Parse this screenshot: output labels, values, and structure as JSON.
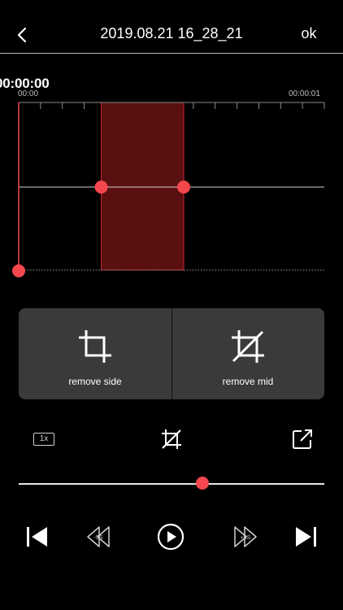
{
  "header": {
    "title": "2019.08.21 16_28_21",
    "ok_label": "ok",
    "back_icon": "chevron-left-icon"
  },
  "timeline": {
    "current_time": "00:00:00",
    "start_label": "00:00",
    "end_label": "00:00:01",
    "selection_start_fraction": 0.27,
    "selection_end_fraction": 0.54,
    "playhead_fraction": 0.0
  },
  "actions": {
    "remove_side_label": "remove side",
    "remove_mid_label": "remove mid"
  },
  "toolbar": {
    "speed_label": "1x"
  },
  "progress": {
    "value_fraction": 0.6
  },
  "controls": {
    "rewind_label": "-5S",
    "forward_label": "+5S"
  },
  "colors": {
    "accent": "#f4474d",
    "selection_fill": "#5a1010",
    "panel_bg": "#3a3a3a"
  }
}
